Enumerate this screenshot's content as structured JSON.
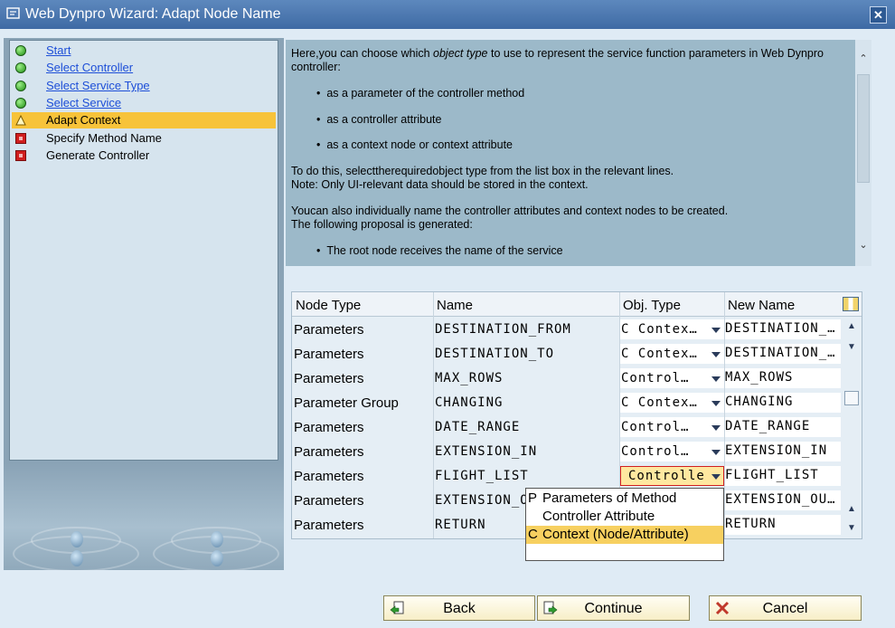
{
  "window": {
    "title": "Web Dynpro Wizard: Adapt Node Name"
  },
  "steps": [
    {
      "label": "Start",
      "status": "done"
    },
    {
      "label": "Select Controller",
      "status": "done"
    },
    {
      "label": "Select Service Type",
      "status": "done"
    },
    {
      "label": "Select Service",
      "status": "done"
    },
    {
      "label": "Adapt Context",
      "status": "current"
    },
    {
      "label": "Specify Method Name",
      "status": "pending"
    },
    {
      "label": "Generate Controller",
      "status": "pending"
    }
  ],
  "info": {
    "intro_prefix": "Here,you can choose which ",
    "intro_em": "object type",
    "intro_suffix": " to use to represent the service function parameters in Web Dynpro controller:",
    "bullets": [
      "as a parameter of the controller method",
      "as a controller attribute",
      "as a context node or context attribute"
    ],
    "todo_line1": "To do this, selecttherequiredobject type from the list box in the relevant lines.",
    "todo_line2": "Note: Only UI-relevant data should be stored in the context.",
    "also_line1": "Youcan also individually name the controller attributes and context nodes to be created.",
    "also_line2": "The following proposal is generated:",
    "bullet_last": "The root node receives the name of the service"
  },
  "table": {
    "headers": [
      "Node Type",
      "Name",
      "Obj. Type",
      "New Name"
    ],
    "rows": [
      {
        "node_type": "Parameters",
        "name": "DESTINATION_FROM",
        "obj_type": "C Contex…",
        "new_name": "DESTINATION_…"
      },
      {
        "node_type": "Parameters",
        "name": "DESTINATION_TO",
        "obj_type": "C Contex…",
        "new_name": "DESTINATION_…"
      },
      {
        "node_type": "Parameters",
        "name": "MAX_ROWS",
        "obj_type": " Control…",
        "new_name": "MAX_ROWS"
      },
      {
        "node_type": "Parameter Group",
        "name": "CHANGING",
        "obj_type": "C Contex…",
        "new_name": "CHANGING"
      },
      {
        "node_type": "Parameters",
        "name": "DATE_RANGE",
        "obj_type": " Control…",
        "new_name": "DATE_RANGE"
      },
      {
        "node_type": "Parameters",
        "name": "EXTENSION_IN",
        "obj_type": " Control…",
        "new_name": "EXTENSION_IN"
      },
      {
        "node_type": "Parameters",
        "name": "FLIGHT_LIST",
        "obj_type": "Controlle",
        "new_name": "FLIGHT_LIST"
      },
      {
        "node_type": "Parameters",
        "name": "EXTENSION_OUT",
        "obj_type": "",
        "new_name": "EXTENSION_OU…"
      },
      {
        "node_type": "Parameters",
        "name": "RETURN",
        "obj_type": "",
        "new_name": "RETURN"
      }
    ]
  },
  "dropdown": {
    "options": [
      {
        "key": "P",
        "label": "Parameters of Method"
      },
      {
        "key": "",
        "label": "Controller Attribute"
      },
      {
        "key": "C",
        "label": "Context (Node/Attribute)",
        "selected": true
      }
    ]
  },
  "buttons": {
    "back": "Back",
    "continue": "Continue",
    "cancel": "Cancel"
  },
  "colors": {
    "title_bar": "#4a77b0",
    "current_step": "#f7c33a",
    "button_bg": "#fbf5dd"
  }
}
